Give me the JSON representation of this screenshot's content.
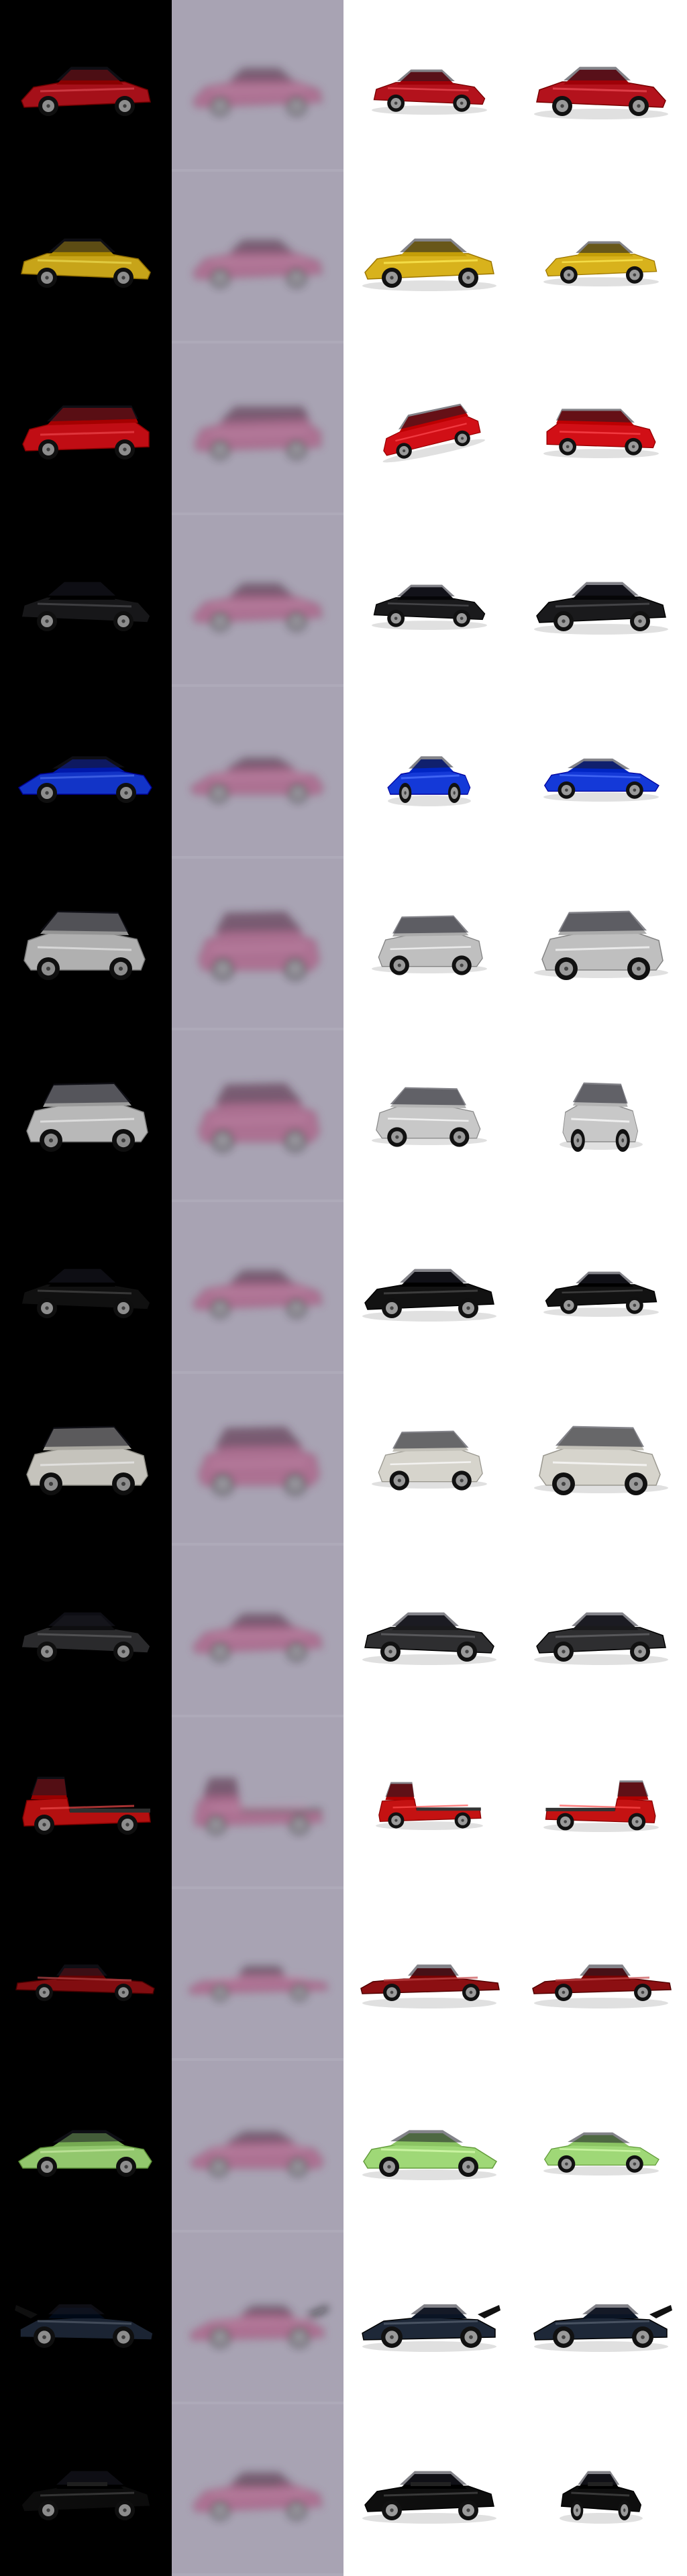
{
  "grid": {
    "rows": 15,
    "columns": [
      "render-dark",
      "render-blurred",
      "render-view-a",
      "render-view-b"
    ]
  },
  "colors": {
    "dark_background": "#000000",
    "blur_background": "#a8a3b3",
    "light_background": "#ffffff"
  },
  "cars": [
    {
      "id": 1,
      "type": "sedan",
      "color": "#b3121c",
      "view_a": "sedan-front-three-quarter",
      "view_b": "sedan-side"
    },
    {
      "id": 2,
      "type": "sedan",
      "color": "#d8b21c",
      "view_a": "sedan-side",
      "view_b": "sedan-front-three-quarter"
    },
    {
      "id": 3,
      "type": "wagon",
      "color": "#d10f16",
      "view_a": "top-front",
      "view_b": "wagon-three-quarter"
    },
    {
      "id": 4,
      "type": "coupe",
      "color": "#1a1a1c",
      "view_a": "rear-three-quarter",
      "view_b": "coupe-side"
    },
    {
      "id": 5,
      "type": "sports",
      "color": "#1439d8",
      "view_a": "top-rear",
      "view_b": "sports-three-quarter"
    },
    {
      "id": 6,
      "type": "suv",
      "color": "#bfbfbf",
      "view_a": "suv-front-three-quarter",
      "view_b": "suv-side"
    },
    {
      "id": 7,
      "type": "suv",
      "color": "#c8c8c8",
      "view_a": "suv-rear-three-quarter",
      "view_b": "rear"
    },
    {
      "id": 8,
      "type": "sedan",
      "color": "#121212",
      "view_a": "sedan-side",
      "view_b": "sedan-front-three-quarter"
    },
    {
      "id": 9,
      "type": "suv",
      "color": "#d6d4cc",
      "view_a": "suv-front-three-quarter",
      "view_b": "suv-side"
    },
    {
      "id": 10,
      "type": "sedan",
      "color": "#2e2e30",
      "view_a": "sedan-side",
      "view_b": "sedan-side"
    },
    {
      "id": 11,
      "type": "truck",
      "color": "#c41212",
      "view_a": "truck-front",
      "view_b": "truck-three-quarter"
    },
    {
      "id": 12,
      "type": "classic",
      "color": "#8c0f12",
      "view_a": "classic-side",
      "view_b": "classic-side"
    },
    {
      "id": 13,
      "type": "sports",
      "color": "#9fd877",
      "view_a": "sports-side",
      "view_b": "sports-three-quarter"
    },
    {
      "id": 14,
      "type": "racecar",
      "color": "#1e2838",
      "view_a": "racecar-side",
      "view_b": "racecar-side"
    },
    {
      "id": 15,
      "type": "convertible",
      "color": "#0e0e0e",
      "view_a": "convertible-side",
      "view_b": "rear"
    }
  ]
}
